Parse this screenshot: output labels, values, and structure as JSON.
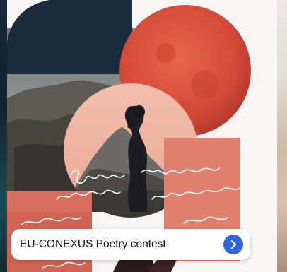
{
  "card": {
    "title": "EU-CONEXUS Poetry contest",
    "action_icon": "chevron-right-icon"
  },
  "colors": {
    "navy": "#1a2b3d",
    "red_moon": "#d9503e",
    "salmon": "#e07f70",
    "peach": "#f0b6a4",
    "button_blue": "#2f64e0"
  }
}
